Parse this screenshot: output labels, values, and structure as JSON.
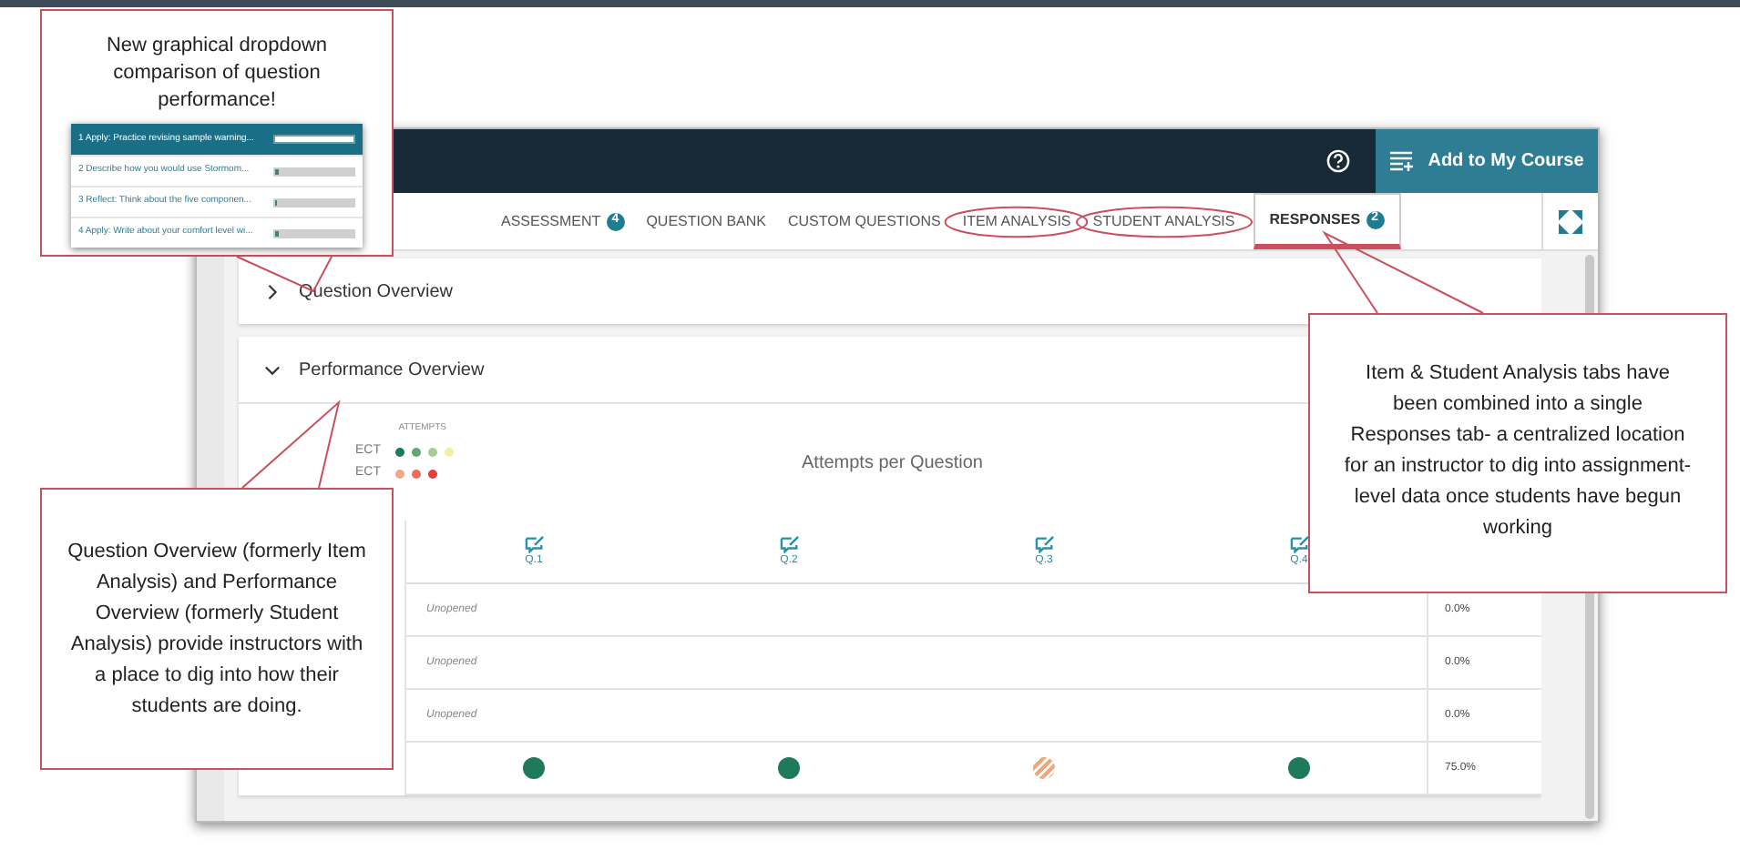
{
  "app": {
    "add_button": "Add to My Course",
    "tabs": [
      {
        "label": "ASSESSMENT",
        "badge": "4",
        "selected": false,
        "circled": false
      },
      {
        "label": "QUESTION BANK",
        "selected": false,
        "circled": false
      },
      {
        "label": "CUSTOM QUESTIONS",
        "selected": false,
        "circled": false
      },
      {
        "label": "ITEM ANALYSIS",
        "selected": false,
        "circled": true
      },
      {
        "label": "STUDENT ANALYSIS",
        "selected": false,
        "circled": true
      },
      {
        "label": "RESPONSES",
        "badge": "2",
        "selected": true,
        "circled": false
      }
    ],
    "sections": [
      {
        "title": "Question Overview",
        "expanded": false
      },
      {
        "title": "Performance Overview",
        "expanded": true
      }
    ],
    "legend": {
      "title": "ATTEMPTS",
      "rows": [
        {
          "label": "ECT",
          "dots": [
            {
              "color": "#1e7a5a"
            },
            {
              "color": "#5fa878"
            },
            {
              "color": "#a3cf95"
            },
            {
              "color": "#f3f0a0"
            }
          ]
        },
        {
          "label": "ECT",
          "dots": [
            {
              "color": "#f0a78a"
            },
            {
              "color": "#ec6a5e"
            },
            {
              "color": "#e0413d"
            }
          ]
        }
      ]
    },
    "chart_title": "Attempts per Question",
    "questions": [
      "Q.1",
      "Q.2",
      "Q.3",
      "Q.4"
    ],
    "rows": [
      {
        "kind": "unopened",
        "status": "Unopened",
        "score": "0.0%"
      },
      {
        "kind": "unopened",
        "status": "Unopened",
        "score": "0.0%"
      },
      {
        "kind": "unopened",
        "status": "Unopened",
        "score": "0.0%"
      },
      {
        "kind": "results",
        "results": [
          {
            "kind": "dot",
            "color": "#1e7a5a"
          },
          {
            "kind": "dot",
            "color": "#1e7a5a"
          },
          {
            "kind": "striped",
            "color": "#f0a77e"
          },
          {
            "kind": "dot",
            "color": "#1e7a5a"
          }
        ],
        "score": "75.0%"
      }
    ]
  },
  "dropdown_callout": {
    "text": "New graphical dropdown comparison of question performance!",
    "items": [
      {
        "label": "1 Apply: Practice revising sample warning...",
        "level": 1,
        "selected": true
      },
      {
        "label": "2 Describe how you would use Stormom...",
        "level": 0.05,
        "selected": false
      },
      {
        "label": "3 Reflect: Think about the five componen...",
        "level": 0.03,
        "selected": false
      },
      {
        "label": "4 Apply: Write about your comfort level wi...",
        "level": 0.05,
        "selected": false
      }
    ]
  },
  "sections_callout": {
    "text": "Question Overview (formerly Item Analysis) and Performance Overview (formerly Student Analysis) provide instructors with a place to dig into how their students are doing."
  },
  "tabs_callout": {
    "text": "Item & Student Analysis tabs have been combined into a single Responses tab- a centralized location for an instructor to dig into assignment-level data once students have begun working"
  }
}
